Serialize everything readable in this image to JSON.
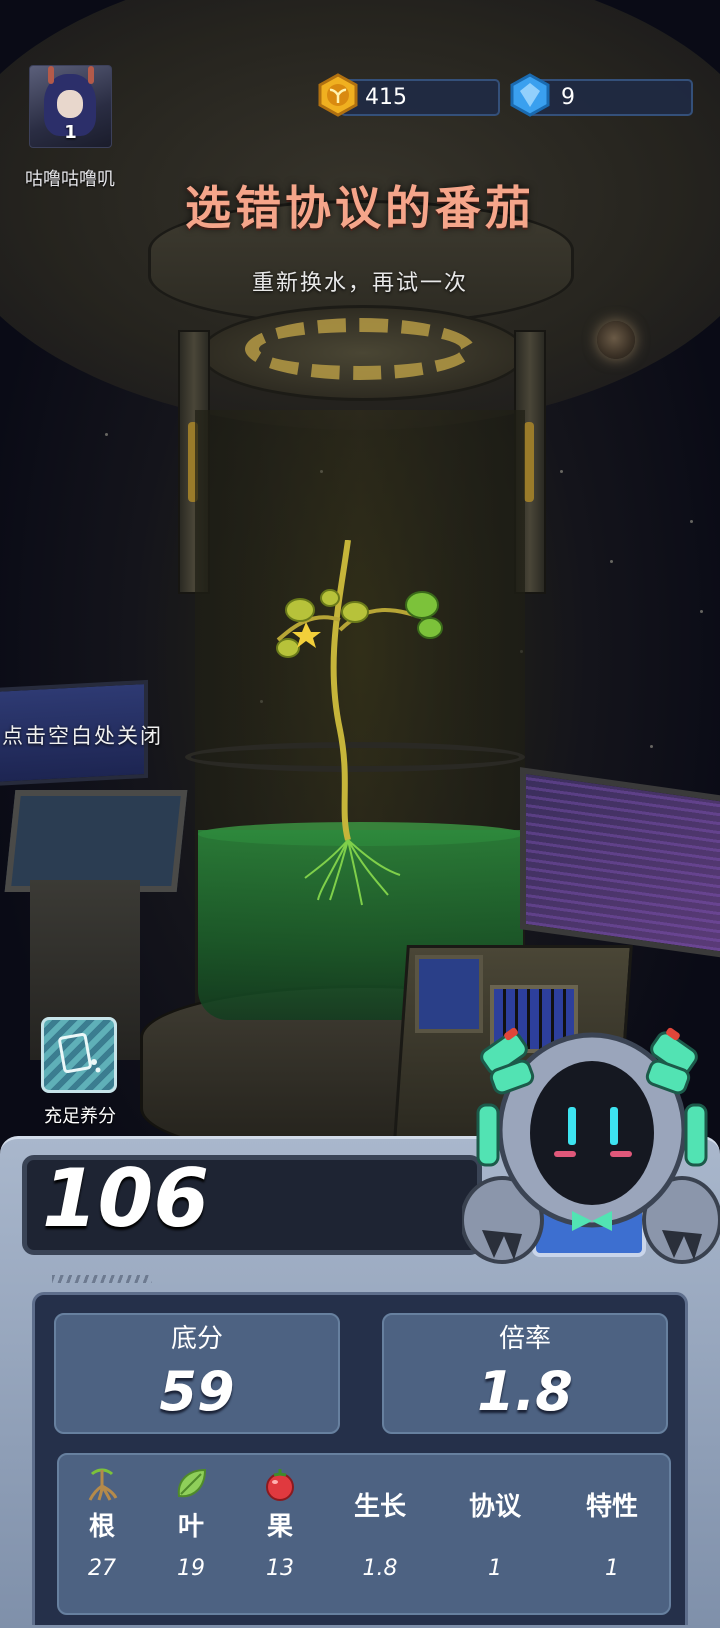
{
  "player": {
    "name": "咕噜咕噜叽",
    "level": "1"
  },
  "resources": [
    {
      "icon": "sprout-coin-icon",
      "value": "415",
      "color": "#f0b020"
    },
    {
      "icon": "blue-gem-icon",
      "value": "9",
      "color": "#3aa0ef"
    }
  ],
  "result": {
    "title": "选错协议的番茄",
    "subtitle": "重新换水，再试一次",
    "close_hint": "点击空白处关闭"
  },
  "nutrient_button": {
    "label": "充足养分",
    "icon": "nutrient-card-icon"
  },
  "score": {
    "total": "106",
    "base_label": "底分",
    "base_value": "59",
    "multiplier_label": "倍率",
    "multiplier_value": "1.8"
  },
  "details": [
    {
      "label": "根",
      "value": "27",
      "icon": "root-icon"
    },
    {
      "label": "叶",
      "value": "19",
      "icon": "leaf-icon"
    },
    {
      "label": "果",
      "value": "13",
      "icon": "tomato-icon"
    },
    {
      "label": "生长",
      "value": "1.8"
    },
    {
      "label": "协议",
      "value": "1"
    },
    {
      "label": "特性",
      "value": "1"
    }
  ],
  "colors": {
    "title": "#f5a58a",
    "panel": "#4d6282",
    "panel_dark": "#25304a",
    "robot_accent": "#52e3b3"
  }
}
